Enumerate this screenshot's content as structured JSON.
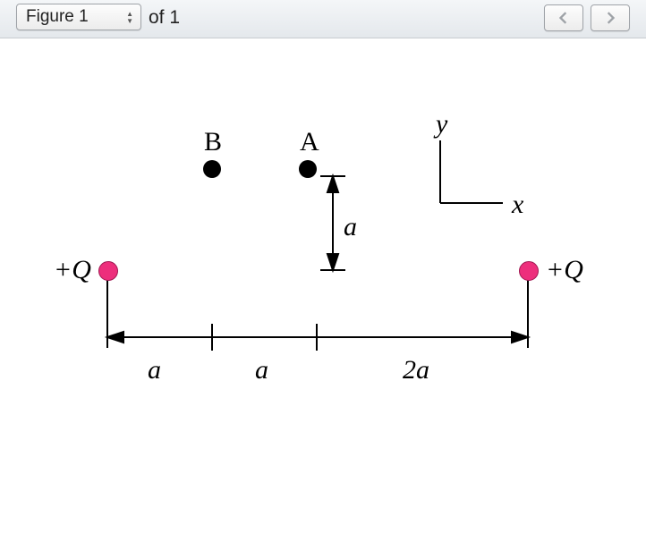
{
  "toolbar": {
    "figure_selector_label": "Figure 1",
    "of_text": "of 1"
  },
  "diagram": {
    "label_B": "B",
    "label_A": "A",
    "axis_y": "y",
    "axis_x": "x",
    "charge_left": "+Q",
    "charge_right": "+Q",
    "dim_v": "a",
    "dim_h1": "a",
    "dim_h2": "a",
    "dim_h3": "2a",
    "points": [
      "B",
      "A",
      "+Q left",
      "+Q right"
    ],
    "horiz_spacing_units": [
      "a",
      "a",
      "2a"
    ],
    "vert_spacing_units": "a",
    "axes": {
      "x": "x",
      "y": "y"
    },
    "charges": [
      {
        "name": "+Q",
        "sign": "positive",
        "position": "left"
      },
      {
        "name": "+Q",
        "sign": "positive",
        "position": "right"
      }
    ]
  }
}
